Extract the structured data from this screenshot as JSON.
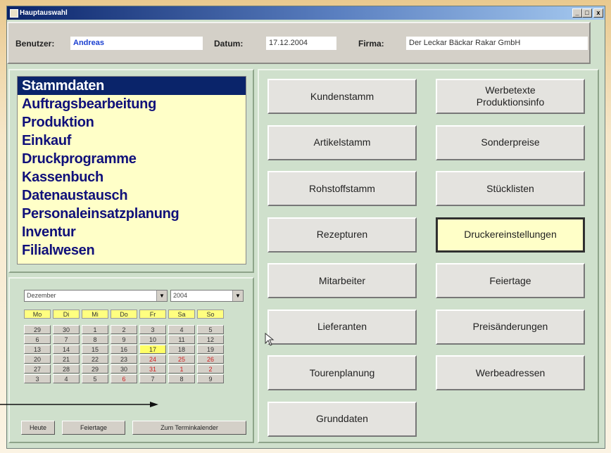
{
  "window": {
    "title": "Hauptauswahl",
    "min": "_",
    "max": "□",
    "close": "x"
  },
  "header": {
    "user_label": "Benutzer:",
    "user_value": "Andreas",
    "date_label": "Datum:",
    "date_value": "17.12.2004",
    "company_label": "Firma:",
    "company_value": "Der Leckar Bäckar Rakar GmbH"
  },
  "menu": [
    "Stammdaten",
    "Auftragsbearbeitung",
    "Produktion",
    "Einkauf",
    "Druckprogramme",
    "Kassenbuch",
    "Datenaustausch",
    "Personaleinsatzplanung",
    "Inventur",
    "Filialwesen"
  ],
  "calendar": {
    "month": "Dezember",
    "year": "2004",
    "weekdays": [
      "Mo",
      "Di",
      "Mi",
      "Do",
      "Fr",
      "Sa",
      "So"
    ],
    "weeks": [
      [
        "29",
        "30",
        "1",
        "2",
        "3",
        "4",
        "5"
      ],
      [
        "6",
        "7",
        "8",
        "9",
        "10",
        "11",
        "12"
      ],
      [
        "13",
        "14",
        "15",
        "16",
        "17",
        "18",
        "19"
      ],
      [
        "20",
        "21",
        "22",
        "23",
        "24",
        "25",
        "26"
      ],
      [
        "27",
        "28",
        "29",
        "30",
        "31",
        "1",
        "2"
      ],
      [
        "3",
        "4",
        "5",
        "6",
        "7",
        "8",
        "9"
      ]
    ],
    "buttons": [
      "Heute",
      "Feiertage",
      "Zum Terminkalender"
    ]
  },
  "buttons": {
    "left": [
      "Kundenstamm",
      "Artikelstamm",
      "Rohstoffstamm",
      "Rezepturen",
      "Mitarbeiter",
      "Lieferanten",
      "Tourenplanung",
      "Grunddaten"
    ],
    "right": [
      "Werbetexte\nProduktionsinfo",
      "Sonderpreise",
      "Stücklisten",
      "Druckereinstellungen",
      "Feiertage",
      "Preisänderungen",
      "Werbeadressen"
    ]
  },
  "colors": {
    "menu_bg": "#ffffc8",
    "menu_text": "#10107a",
    "selected_bg": "#0a246a",
    "today": "#ffff66"
  }
}
